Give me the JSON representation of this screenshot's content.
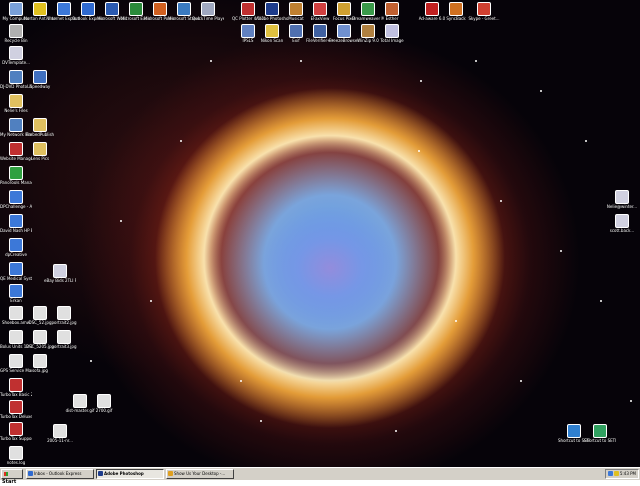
{
  "taskbar": {
    "start_label": "Start",
    "buttons": [
      {
        "label": "Inbox - Outlook Express",
        "color": "#2f6ad0"
      },
      {
        "label": "Adobe Photoshop",
        "color": "#1e3c8c"
      },
      {
        "label": "Show Us Your Desktop -...",
        "color": "#e0a020"
      }
    ],
    "clock": "5:43 PM"
  },
  "icons": {
    "top": [
      {
        "label": "My Computer",
        "color": "#7aa0d8"
      },
      {
        "label": "Norton AntiVirus 2...",
        "color": "#e0c020"
      },
      {
        "label": "Internet Explorer",
        "color": "#3c78d8"
      },
      {
        "label": "Outlook Express",
        "color": "#2f6ad0"
      },
      {
        "label": "Microsoft Word",
        "color": "#2a5ab0"
      },
      {
        "label": "Microsoft Excel",
        "color": "#2a8a3a"
      },
      {
        "label": "Microsoft PowerPoint",
        "color": "#d06020"
      },
      {
        "label": "Microsoft Streets & Trips",
        "color": "#3a7ac0"
      },
      {
        "label": "QuickTime Player",
        "color": "#a0a8c0"
      },
      {
        "label": "QC Plotter 4.5.2.2",
        "color": "#c03030"
      },
      {
        "label": "Adobe Photoshop CS",
        "color": "#1e3c8c"
      },
      {
        "label": "Musicat",
        "color": "#c08030"
      },
      {
        "label": "EFaxView",
        "color": "#d04040"
      },
      {
        "label": "Focus Pixel",
        "color": "#d0a030"
      },
      {
        "label": "Dreamweaver MX",
        "color": "#3a9a4a"
      },
      {
        "label": "Esther",
        "color": "#c06030"
      },
      {
        "label": "Ad-aware 6.0",
        "color": "#c02020"
      },
      {
        "label": "SyncBack",
        "color": "#d07020"
      },
      {
        "label": "Skype - Greet...",
        "color": "#d04030"
      },
      {
        "label": "IPSLS",
        "color": "#6080c0"
      },
      {
        "label": "Nikon Scan",
        "color": "#e0c040"
      },
      {
        "label": "Exif",
        "color": "#5070b0"
      },
      {
        "label": "FileVerifier++",
        "color": "#4060a0"
      },
      {
        "label": "BreezeBrowser",
        "color": "#7090d0"
      },
      {
        "label": "WinZip 9.0",
        "color": "#b08040"
      },
      {
        "label": "Total Image",
        "color": "#c0c0e0"
      }
    ],
    "left": [
      {
        "label": "Recycle Bin",
        "color": "#b0b0b0"
      },
      {
        "label": "DVTemplate...",
        "color": "#d0d0e0"
      },
      {
        "label": "DJ-DVD PhotoLib...",
        "color": "#5080c0"
      },
      {
        "label": "Speedway",
        "color": "#4070c0"
      },
      {
        "label": "Nelie's Files",
        "color": "#e0c060"
      },
      {
        "label": "My Network Places",
        "color": "#5080c0"
      },
      {
        "label": "EmbedPublish",
        "color": "#e0c060"
      },
      {
        "label": "Website Manager",
        "color": "#c03030"
      },
      {
        "label": "Lens Pics",
        "color": "#e0c060"
      },
      {
        "label": "PanoTools Manager",
        "color": "#30a040"
      },
      {
        "label": "DPChallenge - A Digital Ph...",
        "color": "#3c78d8"
      },
      {
        "label": "David Nash HP Enterprise",
        "color": "#3c78d8"
      },
      {
        "label": "dpCreative",
        "color": "#3c78d8"
      },
      {
        "label": "QE Medical Systems",
        "color": "#3c78d8"
      },
      {
        "label": "eBay Bids 2TLI PROFIL...",
        "color": "#d0d0e0"
      },
      {
        "label": "Erkan",
        "color": "#3c78d8"
      },
      {
        "label": "Shoebox.amw",
        "color": "#e0e0e0"
      },
      {
        "label": "DSC_52.jpg",
        "color": "#e0e0e0"
      },
      {
        "label": "portrait2.jpg",
        "color": "#e0e0e0"
      },
      {
        "label": "Bolus Units 12-15-09...",
        "color": "#e0e0e0"
      },
      {
        "label": "DSC_5205.jpg",
        "color": "#e0e0e0"
      },
      {
        "label": "portrait3.jpg",
        "color": "#e0e0e0"
      },
      {
        "label": "GPS Service Manual.pdf",
        "color": "#e0e0e0"
      },
      {
        "label": "sofa.jpg",
        "color": "#e0e0e0"
      },
      {
        "label": "TurboTax Basic 2004",
        "color": "#c03030"
      },
      {
        "label": "TurboTax Deluxe/Business...",
        "color": "#c03030"
      },
      {
        "label": "TurboTax Support",
        "color": "#c03030"
      },
      {
        "label": "dist-master.gif",
        "color": "#e0e0e0"
      },
      {
        "label": "2700.gif",
        "color": "#e0e0e0"
      },
      {
        "label": "2005-11-nr...",
        "color": "#e0e0e0"
      },
      {
        "label": "notes.log",
        "color": "#e0e0e0"
      }
    ],
    "right": [
      {
        "label": "Nelie@winter...",
        "color": "#d0d0e0"
      },
      {
        "label": "scott.back...",
        "color": "#d0d0e0"
      },
      {
        "label": "Shortcut to SETI Driver",
        "color": "#3080d0"
      },
      {
        "label": "Shortcut to SETI tray",
        "color": "#30a060"
      }
    ]
  }
}
